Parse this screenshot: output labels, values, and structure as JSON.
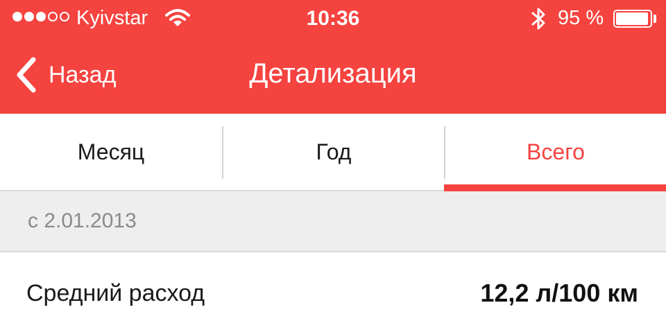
{
  "status_bar": {
    "carrier": "Kyivstar",
    "time": "10:36",
    "battery_percent": "95 %",
    "battery_level": 0.95,
    "signal_bars_filled": 3,
    "signal_bars_total": 5,
    "icons": [
      "wifi-icon",
      "bluetooth-icon",
      "battery-icon"
    ]
  },
  "nav": {
    "back_label": "Назад",
    "title": "Детализация"
  },
  "tabs": [
    {
      "label": "Месяц",
      "active": false
    },
    {
      "label": "Год",
      "active": false
    },
    {
      "label": "Всего",
      "active": true
    }
  ],
  "section": {
    "date_label": "с 2.01.2013"
  },
  "rows": [
    {
      "label": "Средний расход",
      "value": "12,2 л/100 км"
    }
  ],
  "colors": {
    "accent": "#f5433f",
    "section_bg": "#eeeeee",
    "text": "#1a1a1a",
    "muted": "#8a8a8a"
  }
}
